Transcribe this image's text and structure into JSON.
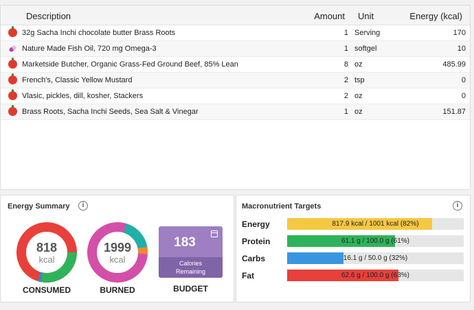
{
  "table": {
    "headers": {
      "description": "Description",
      "amount": "Amount",
      "unit": "Unit",
      "energy": "Energy (kcal)"
    },
    "rows": [
      {
        "icon": "apple-icon",
        "description": "32g Sacha Inchi chocolate butter Brass Roots",
        "amount": "1",
        "unit": "Serving",
        "energy": "170"
      },
      {
        "icon": "pill-icon",
        "description": "Nature Made Fish Oil, 720 mg Omega-3",
        "amount": "1",
        "unit": "softgel",
        "energy": "10"
      },
      {
        "icon": "apple-icon",
        "description": "Marketside Butcher, Organic Grass-Fed Ground Beef, 85% Lean",
        "amount": "8",
        "unit": "oz",
        "energy": "485.99"
      },
      {
        "icon": "apple-icon",
        "description": "French's, Classic Yellow Mustard",
        "amount": "2",
        "unit": "tsp",
        "energy": "0"
      },
      {
        "icon": "apple-icon",
        "description": "Vlasic, pickles, dill, kosher, Stackers",
        "amount": "2",
        "unit": "oz",
        "energy": "0"
      },
      {
        "icon": "apple-icon",
        "description": "Brass Roots, Sacha Inchi Seeds, Sea Salt & Vinegar",
        "amount": "1",
        "unit": "oz",
        "energy": "151.87"
      }
    ]
  },
  "energy_summary": {
    "title": "Energy Summary",
    "info_icon": "info-icon",
    "consumed": {
      "value": "818",
      "unit": "kcal",
      "caption": "CONSUMED",
      "colors": [
        "#e8403a",
        "#2fb35a",
        "#3a87d0"
      ]
    },
    "burned": {
      "value": "1999",
      "unit": "kcal",
      "caption": "BURNED",
      "colors": [
        "#d44fa8",
        "#20b0a8",
        "#f08a2c"
      ]
    },
    "budget": {
      "value": "183",
      "label_line1": "Calories",
      "label_line2": "Remaining",
      "caption": "BUDGET",
      "color": "#9d7fc2"
    }
  },
  "macros": {
    "title": "Macronutrient Targets",
    "info_icon": "info-icon",
    "items": [
      {
        "label": "Energy",
        "text": "817.9 kcal / 1001 kcal (82%)",
        "fraction": 0.82,
        "color": "#f5c842"
      },
      {
        "label": "Protein",
        "text": "61.1 g / 100.0 g (61%)",
        "fraction": 0.61,
        "color": "#2fb35a"
      },
      {
        "label": "Carbs",
        "text": "16.1 g / 50.0 g (32%)",
        "fraction": 0.32,
        "color": "#3a95e0"
      },
      {
        "label": "Fat",
        "text": "62.6 g / 100.0 g (63%)",
        "fraction": 0.63,
        "color": "#e8403a"
      }
    ]
  }
}
